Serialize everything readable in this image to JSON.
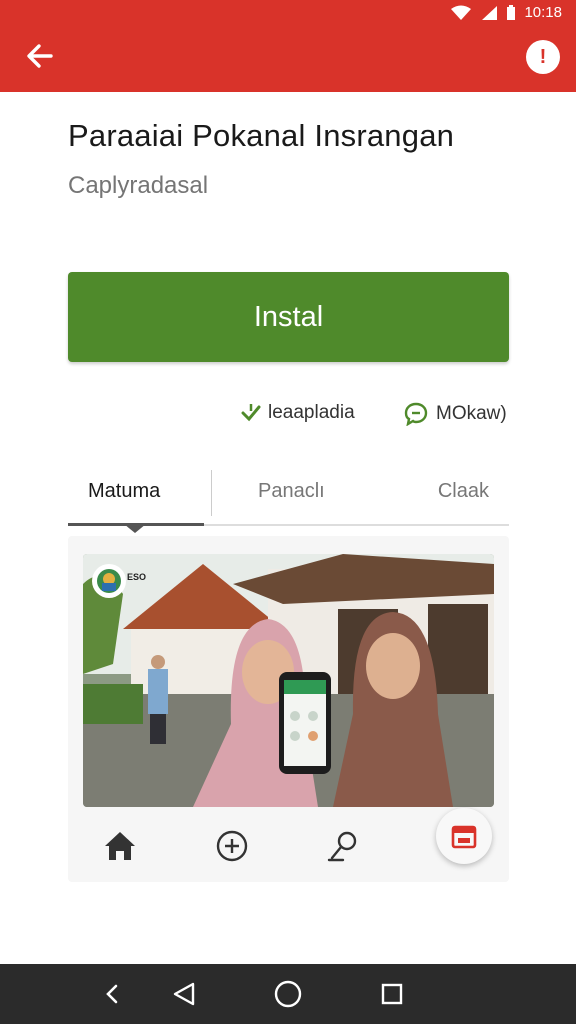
{
  "status_bar": {
    "time": "10:18"
  },
  "app_bar": {
    "back_icon": "arrow-left-icon",
    "info_icon": "info-icon",
    "info_glyph": "!"
  },
  "app": {
    "title": "Paraaiai Pokanal Insrangan",
    "subtitle": "Caplyradasal",
    "install_label": "Instal",
    "meta_download": "leaapladia",
    "meta_reviews": "MOkaw)"
  },
  "tabs": [
    "Matuma",
    "Panaclı",
    "Claak"
  ],
  "card": {
    "badge_text": "ESO",
    "nav_icons": [
      "home-icon",
      "plus-circle-icon",
      "search-icon",
      "calendar-icon"
    ]
  },
  "colors": {
    "primary": "#d9332a",
    "install": "#4f8a2b"
  }
}
